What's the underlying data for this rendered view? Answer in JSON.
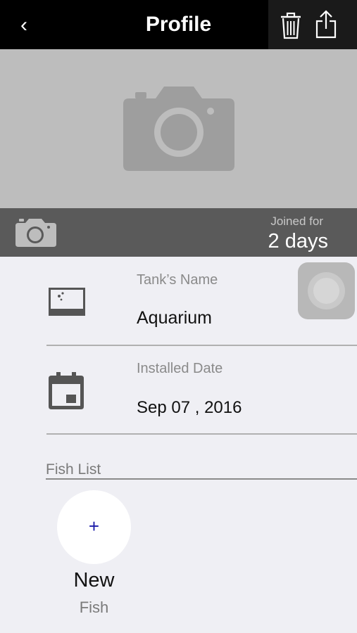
{
  "navbar": {
    "back_icon": "chevron-left-icon",
    "back_glyph": "‹",
    "title": "Profile",
    "trash_icon": "trash-icon",
    "share_icon": "share-icon"
  },
  "cover": {
    "icon": "camera-icon"
  },
  "info_bar": {
    "camera_icon": "camera-icon",
    "joined_label": "Joined for",
    "joined_value": "2 days"
  },
  "tank": {
    "icon": "aquarium-icon",
    "label": "Tank’s Name",
    "value": "Aquarium"
  },
  "installed": {
    "icon": "calendar-icon",
    "label": "Installed Date",
    "value": "Sep 07 , 2016"
  },
  "fish_list": {
    "header": "Fish List",
    "add_glyph": "+",
    "new_label": "New",
    "fish_label": "Fish"
  },
  "colors": {
    "navbar": "#000000",
    "cover": "#bdbdbd",
    "info_bar": "#5a5a5a",
    "background": "#efeff4",
    "accent_plus": "#1a1aa8"
  }
}
